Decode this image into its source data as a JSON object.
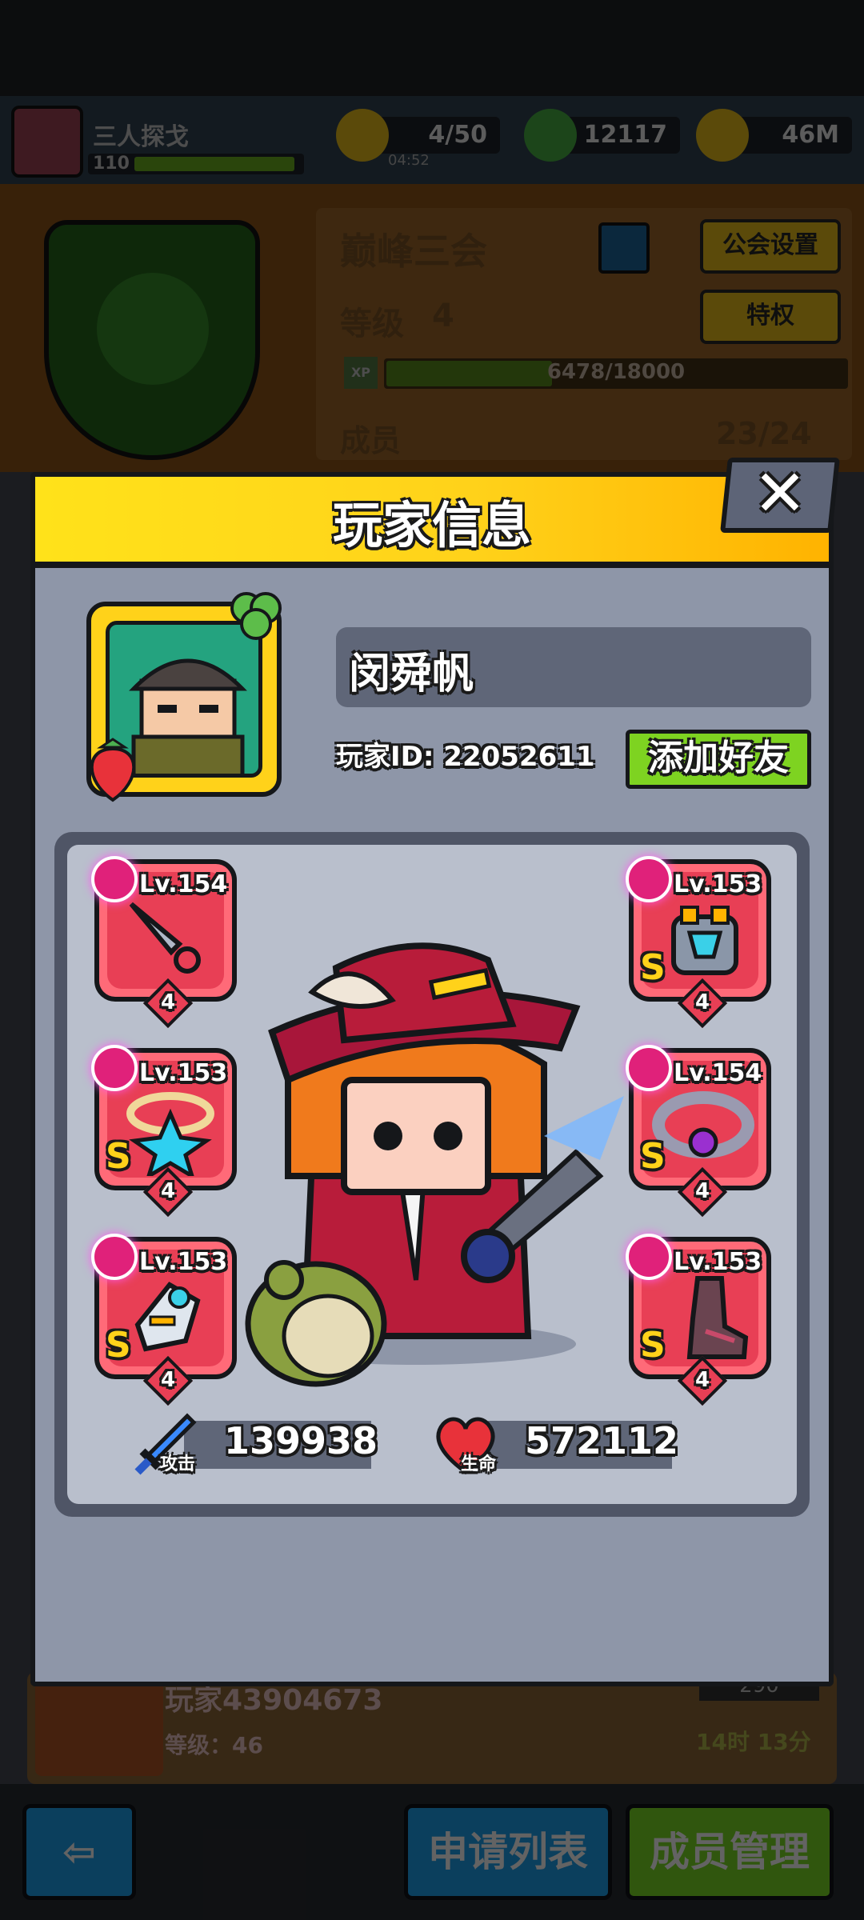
{
  "header": {
    "username": "三人探戈",
    "level": "110",
    "energy": "4/50",
    "energy_timer": "04:52",
    "gems": "12117",
    "gold": "46M"
  },
  "guild": {
    "name": "巅峰三会",
    "level_label": "等级",
    "level_value": "4",
    "xp_badge": "XP",
    "xp_progress": "6478/18000",
    "xp_fraction": 0.36,
    "members_label": "成员",
    "members_value": "23/24",
    "settings_button": "公会设置",
    "privilege_button": "特权"
  },
  "member_row": {
    "name": "玩家43904673",
    "level": "等级：46",
    "points": "290",
    "last_online": "14时 13分"
  },
  "bottom_bar": {
    "apply_list": "申请列表",
    "member_manage": "成员管理"
  },
  "modal": {
    "title": "玩家信息",
    "close_glyph": "✕",
    "player_name": "闵舜帆",
    "player_id": "玩家ID: 22052611",
    "add_friend": "添加好友",
    "equipment": [
      {
        "slot": "weapon",
        "level": "Lv.154",
        "grade": "",
        "stars": "4",
        "icon": "kunai-icon"
      },
      {
        "slot": "armor",
        "level": "Lv.153",
        "grade": "S",
        "stars": "4",
        "icon": "armor-icon"
      },
      {
        "slot": "necklace",
        "level": "Lv.153",
        "grade": "S",
        "stars": "4",
        "icon": "necklace-icon"
      },
      {
        "slot": "belt",
        "level": "Lv.154",
        "grade": "S",
        "stars": "4",
        "icon": "belt-icon"
      },
      {
        "slot": "gloves",
        "level": "Lv.153",
        "grade": "S",
        "stars": "4",
        "icon": "gauntlet-icon"
      },
      {
        "slot": "boots",
        "level": "Lv.153",
        "grade": "S",
        "stars": "4",
        "icon": "boots-icon"
      }
    ],
    "attack_label": "攻击",
    "attack_value": "139938",
    "hp_label": "生命",
    "hp_value": "572112"
  }
}
